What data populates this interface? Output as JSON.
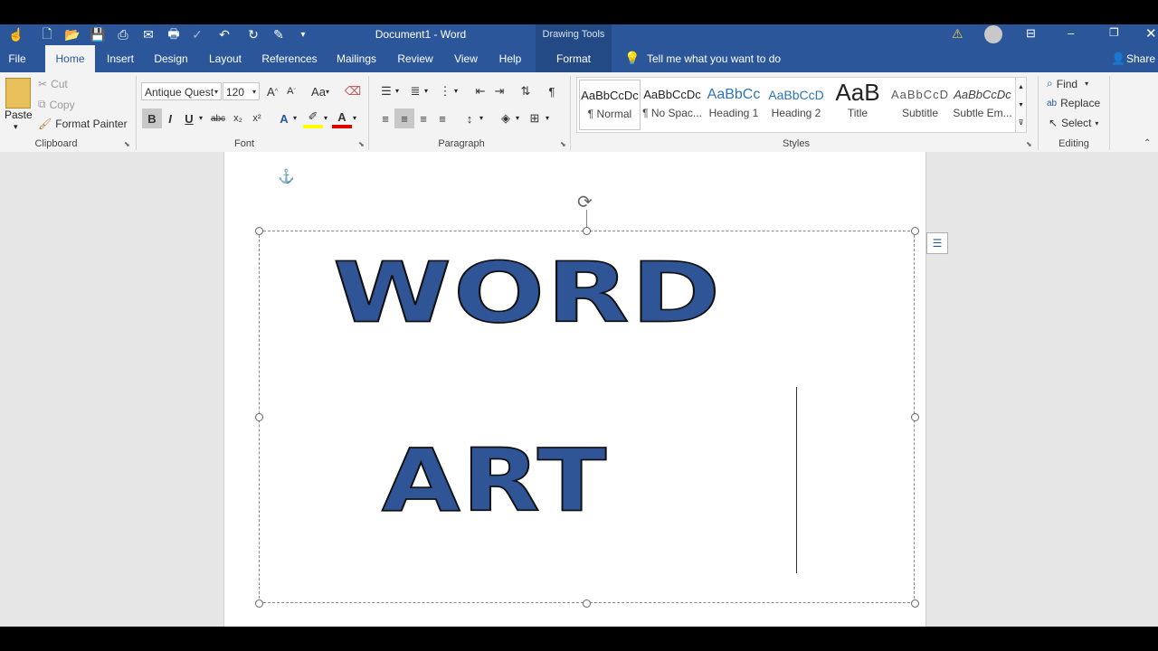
{
  "window": {
    "title": "Document1  -  Word",
    "contextual_group": "Drawing Tools",
    "warning_icon": "warning-icon",
    "colors": {
      "accent": "#2b579a",
      "ribbon_bg": "#f3f3f3",
      "wordart_fill": "#2f5597"
    }
  },
  "quick_access": [
    "touch-mode-icon",
    "new-doc-icon",
    "open-icon",
    "save-icon",
    "print-preview-icon",
    "email-icon",
    "print-icon",
    "spellcheck-icon",
    "undo-icon",
    "redo-icon",
    "customize-icon"
  ],
  "tabs": [
    {
      "label": "File"
    },
    {
      "label": "Home"
    },
    {
      "label": "Insert"
    },
    {
      "label": "Design"
    },
    {
      "label": "Layout"
    },
    {
      "label": "References"
    },
    {
      "label": "Mailings"
    },
    {
      "label": "Review"
    },
    {
      "label": "View"
    },
    {
      "label": "Help"
    },
    {
      "label": "Format"
    }
  ],
  "tellme": "Tell me what you want to do",
  "share": "Share",
  "clipboard": {
    "paste": "Paste",
    "cut": "Cut",
    "copy": "Copy",
    "format_painter": "Format Painter",
    "label": "Clipboard"
  },
  "font": {
    "name": "Antique Quest",
    "size": "120",
    "label": "Font",
    "change_case": "Aa",
    "bold": "B",
    "italic": "I",
    "underline": "U",
    "strike": "abc",
    "subscript": "x₂",
    "superscript": "x²",
    "grow": "A^",
    "shrink": "Aˇ"
  },
  "paragraph": {
    "label": "Paragraph"
  },
  "styles": {
    "label": "Styles",
    "items": [
      {
        "sample": "AaBbCcDc",
        "name": "¶ Normal"
      },
      {
        "sample": "AaBbCcDc",
        "name": "¶ No Spac..."
      },
      {
        "sample": "AaBbCc",
        "name": "Heading 1"
      },
      {
        "sample": "AaBbCcD",
        "name": "Heading 2"
      },
      {
        "sample": "AaB",
        "name": "Title"
      },
      {
        "sample": "AaBbCcD",
        "name": "Subtitle"
      },
      {
        "sample": "AaBbCcDc",
        "name": "Subtle Em..."
      }
    ]
  },
  "editing": {
    "find": "Find",
    "replace": "Replace",
    "select": "Select",
    "label": "Editing"
  },
  "document": {
    "wordart_line1": "WORD",
    "wordart_line2": "ART"
  }
}
